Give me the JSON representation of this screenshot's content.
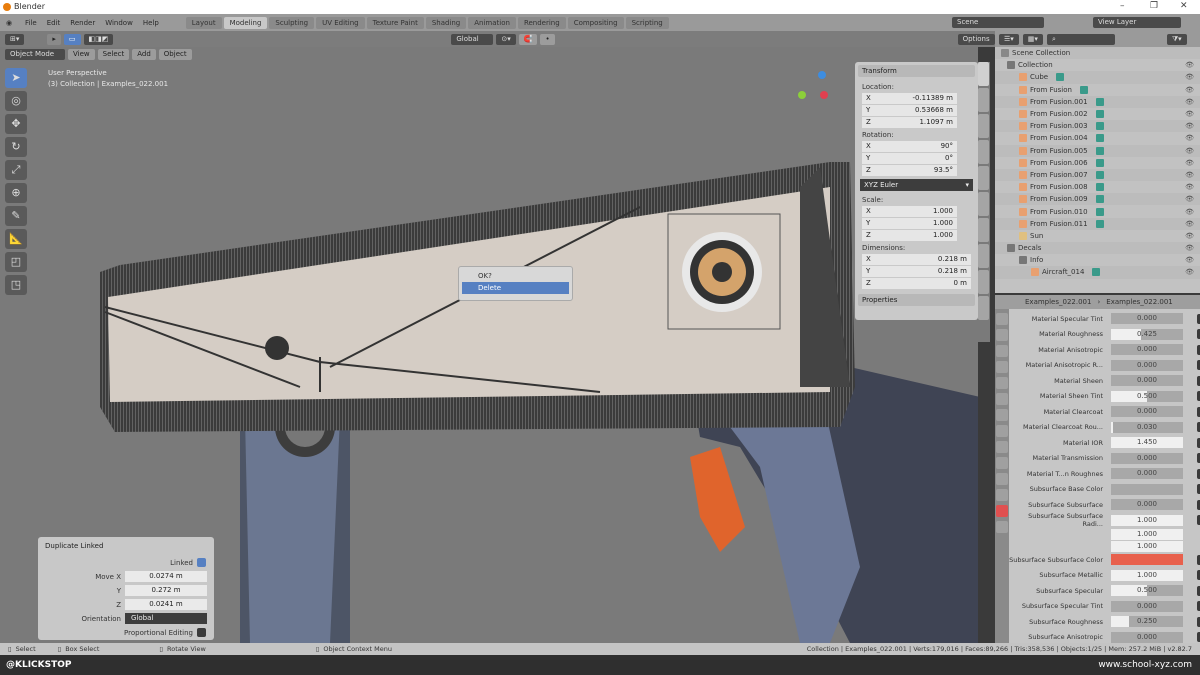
{
  "window": {
    "title": "Blender",
    "controls": [
      "–",
      "❐",
      "✕"
    ]
  },
  "menu": [
    "File",
    "Edit",
    "Render",
    "Window",
    "Help"
  ],
  "workspaces": [
    "Layout",
    "Modeling",
    "Sculpting",
    "UV Editing",
    "Texture Paint",
    "Shading",
    "Animation",
    "Rendering",
    "Compositing",
    "Scripting"
  ],
  "active_workspace": 1,
  "scene": {
    "scene_label": "Scene",
    "view_layer_label": "View Layer"
  },
  "tool_header": {
    "orientation": "Global",
    "options": "Options"
  },
  "viewport_header": {
    "mode": "Object Mode",
    "menus": [
      "View",
      "Select",
      "Add",
      "Object"
    ]
  },
  "viewport_info": {
    "perspective": "User Perspective",
    "collection": "(3) Collection | Examples_022.001"
  },
  "transform": {
    "title": "Transform",
    "location_label": "Location:",
    "location": [
      [
        "X",
        "-0.11389 m"
      ],
      [
        "Y",
        "0.53668 m"
      ],
      [
        "Z",
        "1.1097 m"
      ]
    ],
    "rotation_label": "Rotation:",
    "rotation": [
      [
        "X",
        "90°"
      ],
      [
        "Y",
        "0°"
      ],
      [
        "Z",
        "93.5°"
      ]
    ],
    "rotation_mode": "XYZ Euler",
    "scale_label": "Scale:",
    "scale": [
      [
        "X",
        "1.000"
      ],
      [
        "Y",
        "1.000"
      ],
      [
        "Z",
        "1.000"
      ]
    ],
    "dimensions_label": "Dimensions:",
    "dimensions": [
      [
        "X",
        "0.218 m"
      ],
      [
        "Y",
        "0.218 m"
      ],
      [
        "Z",
        "0 m"
      ]
    ],
    "properties_label": "Properties"
  },
  "popup": {
    "title": "OK?",
    "action": "Delete"
  },
  "outliner": {
    "root": "Scene Collection",
    "items": [
      {
        "name": "Collection",
        "kind": "collection"
      },
      {
        "name": "Cube",
        "kind": "mesh"
      },
      {
        "name": "From Fusion",
        "kind": "mesh"
      },
      {
        "name": "From Fusion.001",
        "kind": "mesh"
      },
      {
        "name": "From Fusion.002",
        "kind": "mesh"
      },
      {
        "name": "From Fusion.003",
        "kind": "mesh"
      },
      {
        "name": "From Fusion.004",
        "kind": "mesh"
      },
      {
        "name": "From Fusion.005",
        "kind": "mesh"
      },
      {
        "name": "From Fusion.006",
        "kind": "mesh"
      },
      {
        "name": "From Fusion.007",
        "kind": "mesh"
      },
      {
        "name": "From Fusion.008",
        "kind": "mesh"
      },
      {
        "name": "From Fusion.009",
        "kind": "mesh"
      },
      {
        "name": "From Fusion.010",
        "kind": "mesh"
      },
      {
        "name": "From Fusion.011",
        "kind": "mesh"
      },
      {
        "name": "Sun",
        "kind": "light"
      },
      {
        "name": "Decals",
        "kind": "collection"
      },
      {
        "name": "Info",
        "kind": "collection"
      },
      {
        "name": "Aircraft_014",
        "kind": "mesh"
      }
    ]
  },
  "properties": {
    "object": "Examples_022.001",
    "material": "Examples_022.001",
    "rows": [
      {
        "label": "Material Specular Tint",
        "value": "0.000",
        "fill": 0
      },
      {
        "label": "Material Roughness",
        "value": "0.425",
        "fill": 0.42
      },
      {
        "label": "Material Anisotropic",
        "value": "0.000",
        "fill": 0
      },
      {
        "label": "Material Anisotropic R...",
        "value": "0.000",
        "fill": 0
      },
      {
        "label": "Material Sheen",
        "value": "0.000",
        "fill": 0
      },
      {
        "label": "Material Sheen Tint",
        "value": "0.500",
        "fill": 0.5
      },
      {
        "label": "Material Clearcoat",
        "value": "0.000",
        "fill": 0
      },
      {
        "label": "Material Clearcoat Rou...",
        "value": "0.030",
        "fill": 0.03
      },
      {
        "label": "Material IOR",
        "value": "1.450",
        "fill": 1
      },
      {
        "label": "Material Transmission",
        "value": "0.000",
        "fill": 0
      },
      {
        "label": "Material T...n Roughnes",
        "value": "0.000",
        "fill": 0
      },
      {
        "label": "Subsurface Base Color",
        "value": "",
        "fill": 0
      },
      {
        "label": "Subsurface Subsurface",
        "value": "0.000",
        "fill": 0
      },
      {
        "label": "Subsurface Subsurface Radi...",
        "value": "1.000",
        "fill": 1
      },
      {
        "label": "",
        "value": "1.000",
        "fill": 1
      },
      {
        "label": "",
        "value": "1.000",
        "fill": 1
      },
      {
        "label": "Subsurface Subsurface Color",
        "value": "",
        "fill": 0,
        "color": "#e8604c"
      },
      {
        "label": "Subsurface Metallic",
        "value": "1.000",
        "fill": 1
      },
      {
        "label": "Subsurface Specular",
        "value": "0.500",
        "fill": 0.5
      },
      {
        "label": "Subsurface Specular Tint",
        "value": "0.000",
        "fill": 0
      },
      {
        "label": "Subsurface Roughness",
        "value": "0.250",
        "fill": 0.25
      },
      {
        "label": "Subsurface Anisotropic",
        "value": "0.000",
        "fill": 0
      }
    ]
  },
  "operator_panel": {
    "title": "Duplicate Linked",
    "linked_label": "Linked",
    "move_x_label": "Move X",
    "move_x": "0.0274 m",
    "y_label": "Y",
    "y": "0.272 m",
    "z_label": "Z",
    "z": "0.0241 m",
    "orientation_label": "Orientation",
    "orientation": "Global",
    "proportional_label": "Proportional Editing"
  },
  "status": {
    "select": "Select",
    "box_select": "Box Select",
    "rotate_view": "Rotate View",
    "context_menu": "Object Context Menu",
    "stats": "Collection | Examples_022.001 | Verts:179,016 | Faces:89,266 | Tris:358,536 | Objects:1/25 | Mem: 257.2 MiB | v2.82.7"
  },
  "watermarks": {
    "left": "@KLICKSTOP",
    "right": "www.school-xyz.com"
  },
  "colors": {
    "accent": "#5680c2",
    "subsurface_color": "#e8604c"
  }
}
